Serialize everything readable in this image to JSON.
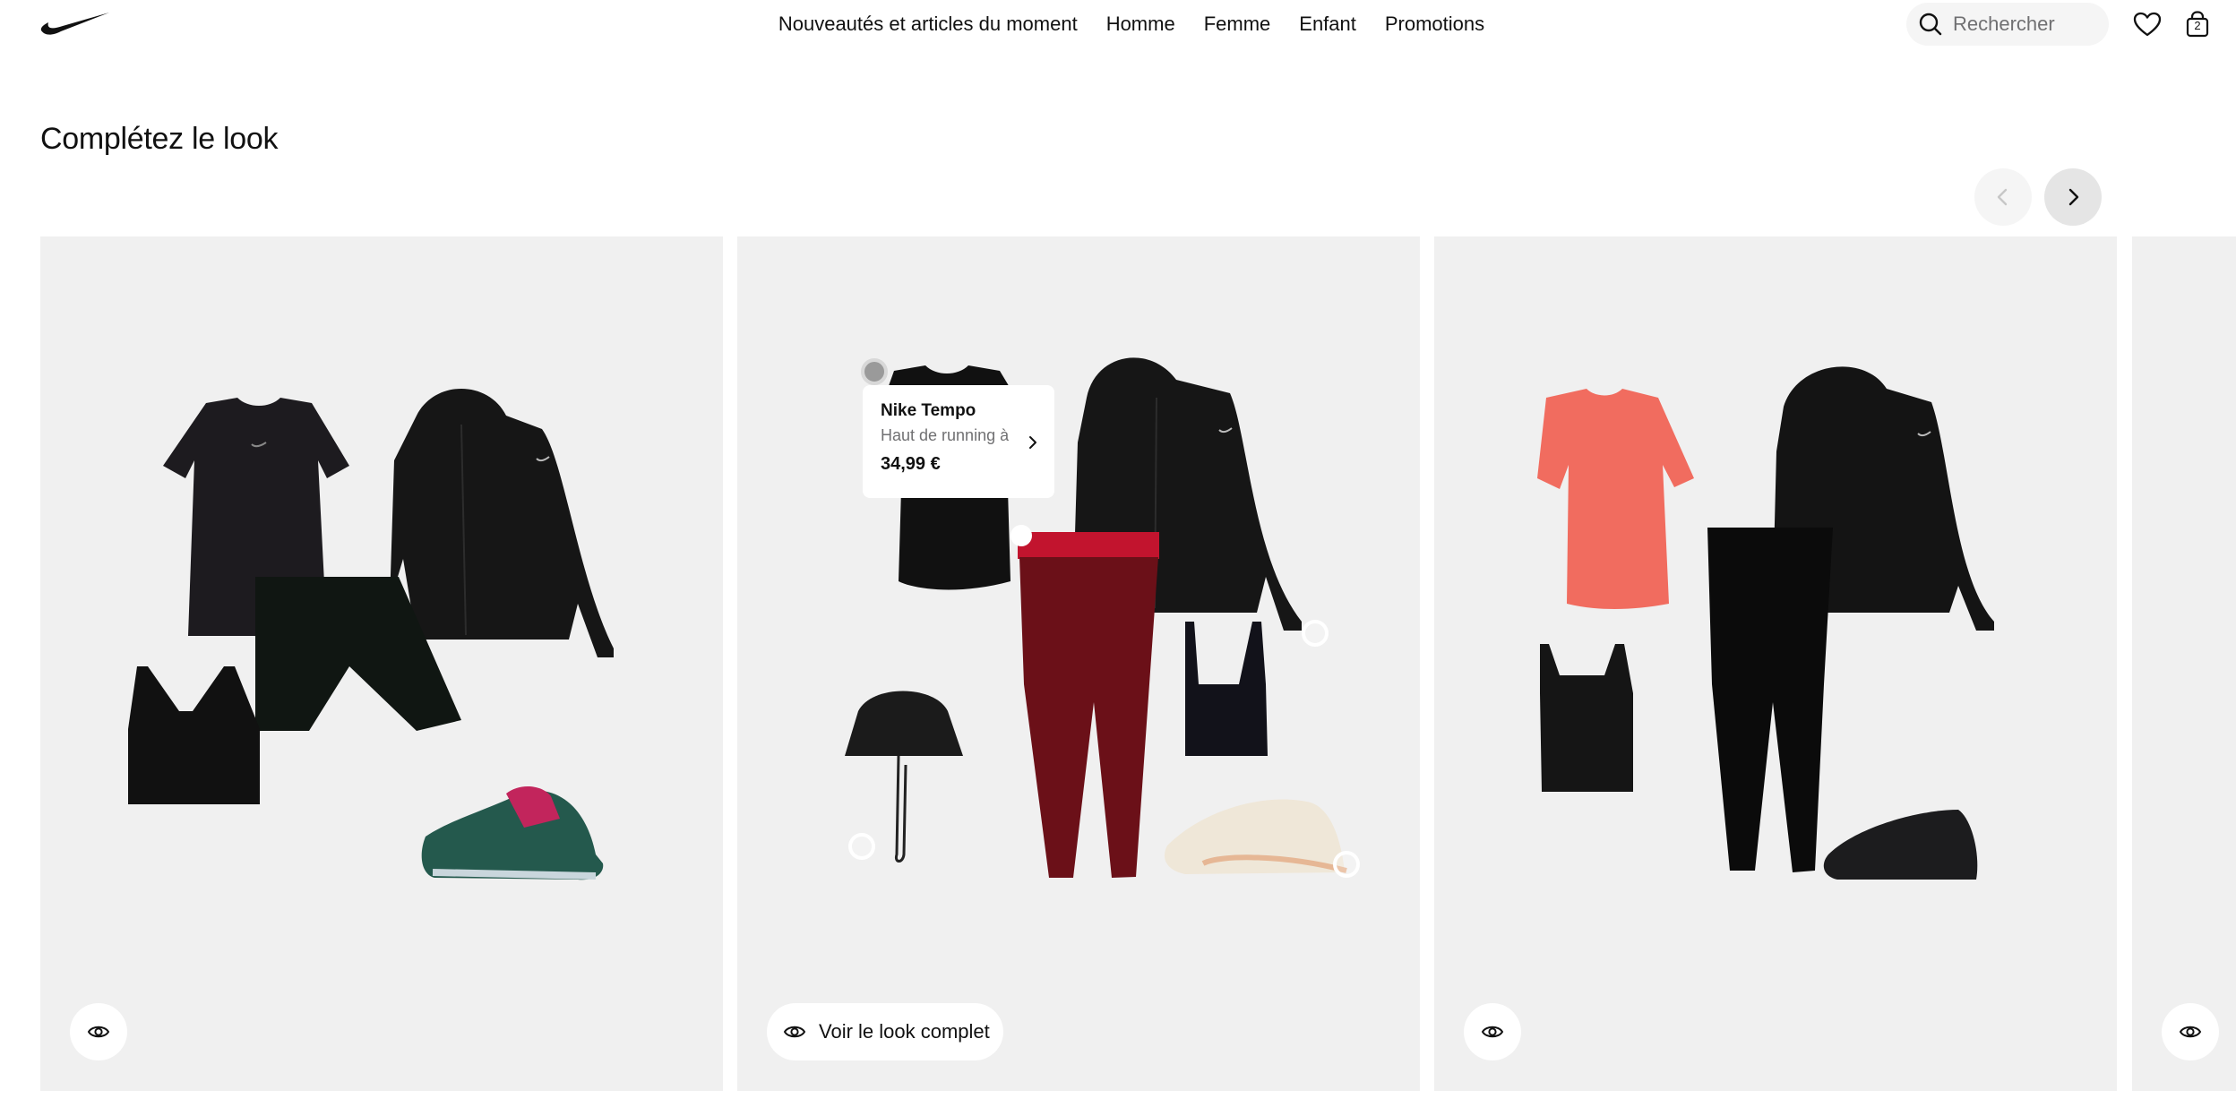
{
  "header": {
    "nav": [
      {
        "label": "Nouveautés et articles du moment"
      },
      {
        "label": "Homme"
      },
      {
        "label": "Femme"
      },
      {
        "label": "Enfant"
      },
      {
        "label": "Promotions"
      }
    ],
    "search": {
      "placeholder": "Rechercher"
    },
    "bag_count": "2",
    "icons": [
      "nike-swoosh-logo",
      "search-icon",
      "heart-icon",
      "bag-icon"
    ]
  },
  "section": {
    "title": "Complétez le look"
  },
  "carousel": {
    "prev_icon": "chevron-left-icon",
    "next_icon": "chevron-right-icon",
    "prev_disabled": true
  },
  "looks": [
    {
      "view_label": ""
    },
    {
      "view_label": "Voir le look complet",
      "tooltip": {
        "name": "Nike Tempo",
        "subtitle": "Haut de running à",
        "price": "34,99 €"
      }
    },
    {
      "view_label": ""
    }
  ],
  "colors": {
    "card_bg": "#f0f0f0",
    "text_primary": "#111111",
    "text_secondary": "#707072",
    "search_bg": "#f5f5f5"
  }
}
